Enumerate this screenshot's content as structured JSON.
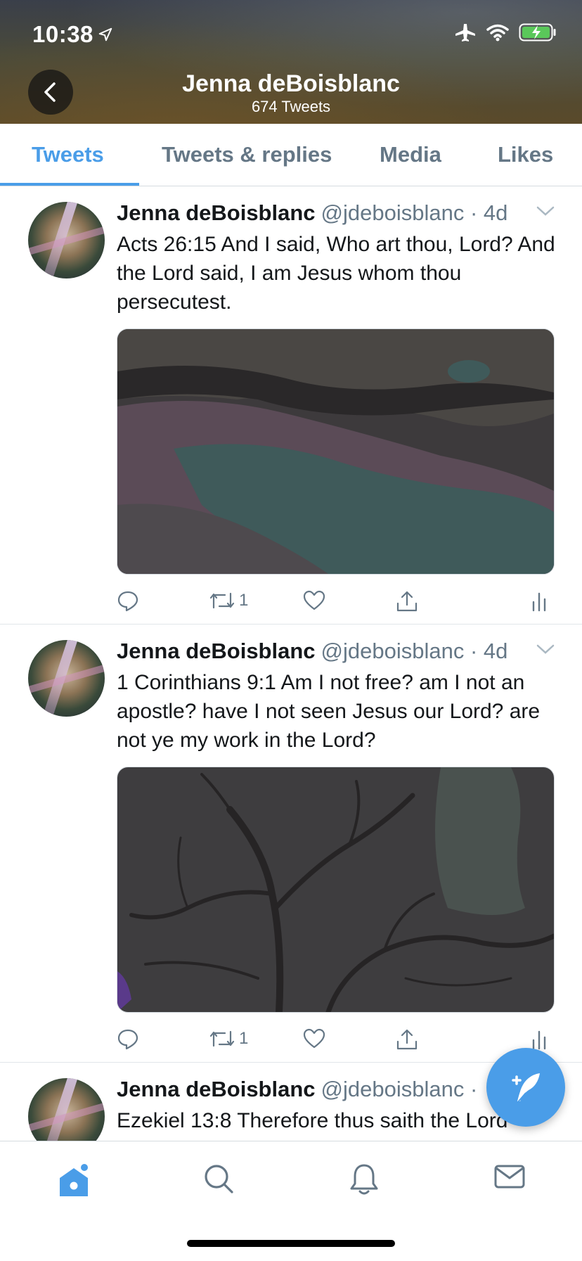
{
  "status_bar": {
    "time": "10:38"
  },
  "header": {
    "title": "Jenna deBoisblanc",
    "tweet_count": "674 Tweets"
  },
  "tabs": [
    {
      "label": "Tweets",
      "active": true
    },
    {
      "label": "Tweets & replies",
      "active": false
    },
    {
      "label": "Media",
      "active": false
    },
    {
      "label": "Likes",
      "active": false
    }
  ],
  "tweets": [
    {
      "name": "Jenna deBoisblanc",
      "handle": "@jdeboisblanc · 4d",
      "text": "Acts 26:15 And I said, Who art thou, Lord? And the Lord said, I am Jesus whom thou persecutest.",
      "retweets": "1"
    },
    {
      "name": "Jenna deBoisblanc",
      "handle": "@jdeboisblanc · 4d",
      "text": "1 Corinthians 9:1 Am I not free? am I not an apostle? have I not seen Jesus our Lord? are not ye my work in the Lord?",
      "retweets": "1"
    },
    {
      "name": "Jenna deBoisblanc",
      "handle": "@jdeboisblanc ·",
      "text": "Ezekiel 13:8 Therefore thus saith the Lord"
    }
  ],
  "colors": {
    "accent": "#4a9de8",
    "secondary_text": "#657786"
  },
  "bottom_nav": [
    "home-icon",
    "search-icon",
    "bell-icon",
    "mail-icon"
  ]
}
